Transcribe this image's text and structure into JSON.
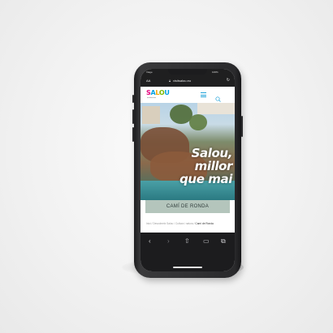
{
  "status_bar": {
    "carrier": "Viage",
    "time": "9:41",
    "battery": "100%"
  },
  "browser": {
    "text_size_label": "AA",
    "url": "visitsalou.eu",
    "toolbar": {
      "back": "‹",
      "forward": "›",
      "share": "⇧",
      "bookmarks": "▭",
      "tabs": "⧉"
    }
  },
  "site": {
    "logo": {
      "l1": "S",
      "l2": "A",
      "l3": "L",
      "l4": "O",
      "l5": "U"
    },
    "logo_sub": "mediterrània",
    "hero": {
      "line1": "Salou,",
      "line2": "millor",
      "line3": "que mai"
    },
    "cta_label": "CAMÍ DE RONDA",
    "breadcrumbs": {
      "trail": "Inici / Descobreix Salou / Cultura i natura /",
      "current": "Camí de Ronda"
    }
  },
  "colors": {
    "logo_pink": "#e6007e",
    "logo_blue": "#00a0e0",
    "logo_orange": "#f7a600",
    "logo_green": "#7ab800",
    "menu_accent": "#1aa0d8",
    "cta_bg": "#b4c5bc"
  },
  "icons": {
    "menu": "hamburger-icon",
    "search": "search-icon",
    "lock": "lock-icon",
    "reload": "reload-icon"
  }
}
